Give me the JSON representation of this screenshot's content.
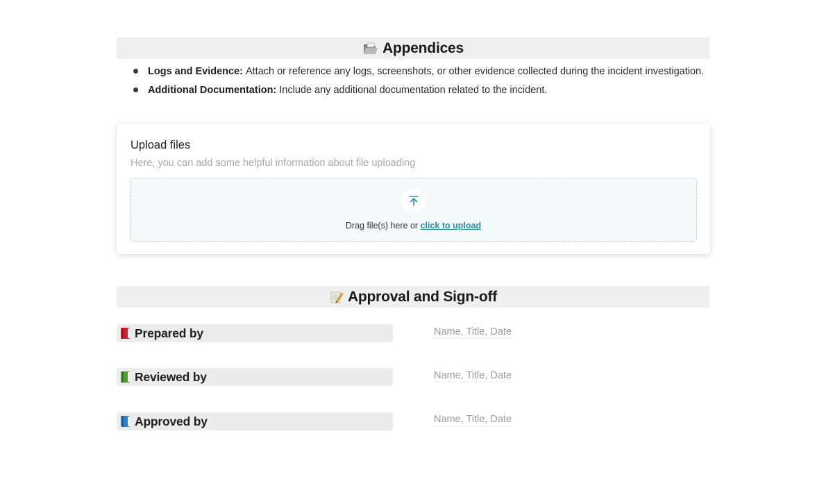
{
  "appendices": {
    "heading": "Appendices",
    "icon": "open-folder-icon",
    "items": [
      {
        "label": "Logs and Evidence:",
        "text": "Attach or reference any logs, screenshots, or other evidence collected during the incident investigation."
      },
      {
        "label": "Additional Documentation:",
        "text": "Include any additional documentation related to the incident."
      }
    ]
  },
  "upload": {
    "title": "Upload files",
    "hint": "Here, you can add some helpful information about file uploading",
    "drop_text": "Drag file(s) here or",
    "link_text": "click to upload",
    "accent_color": "#2b8fa8"
  },
  "approval": {
    "heading": "Approval and Sign-off",
    "icon": "memo-icon",
    "rows": [
      {
        "label": "Prepared by",
        "icon": "red-book-icon",
        "placeholder": "Name, Title, Date"
      },
      {
        "label": "Reviewed by",
        "icon": "green-book-icon",
        "placeholder": "Name, Title, Date"
      },
      {
        "label": "Approved by",
        "icon": "blue-book-icon",
        "placeholder": "Name, Title, Date"
      }
    ]
  }
}
